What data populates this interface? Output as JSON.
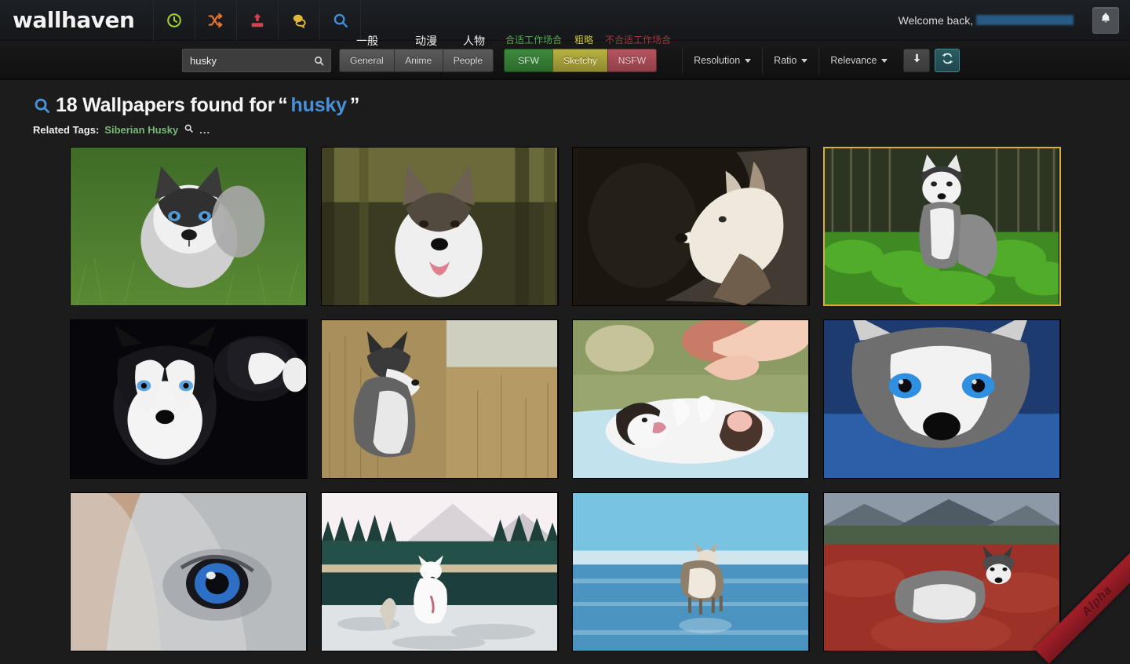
{
  "header": {
    "logo": "wallhaven",
    "nav_icons": [
      {
        "name": "latest-icon",
        "glyph": "clock",
        "color": "#a4d231"
      },
      {
        "name": "random-icon",
        "glyph": "shuffle",
        "color": "#e8732c"
      },
      {
        "name": "upload-icon",
        "glyph": "upload",
        "color": "#d6414f"
      },
      {
        "name": "forums-icon",
        "glyph": "comments",
        "color": "#e0b63b"
      },
      {
        "name": "search-icon",
        "glyph": "magnifier",
        "color": "#3f8ddc"
      }
    ],
    "welcome_text": "Welcome back,",
    "username": "",
    "bell_label": "Notifications"
  },
  "toolbar": {
    "search": {
      "value": "husky",
      "placeholder": "Search...",
      "button_label": "Search"
    },
    "categories": [
      {
        "label": "General",
        "cn": "一般",
        "active": true
      },
      {
        "label": "Anime",
        "cn": "动漫",
        "active": true
      },
      {
        "label": "People",
        "cn": "人物",
        "active": true
      }
    ],
    "purity": [
      {
        "label": "SFW",
        "cn": "合适工作场合",
        "color": "#4caf50",
        "active": true
      },
      {
        "label": "Sketchy",
        "cn": "粗略",
        "color": "#c9c339",
        "active": true
      },
      {
        "label": "NSFW",
        "cn": "不合适工作场合",
        "color": "#a3373f",
        "active": false
      }
    ],
    "dropdowns": [
      {
        "label": "Resolution"
      },
      {
        "label": "Ratio"
      },
      {
        "label": "Relevance"
      }
    ],
    "order_button": "descending",
    "refresh_button": "refresh"
  },
  "results": {
    "count": "18",
    "heading_prefix": "18 Wallpapers found for",
    "quote_open": "“",
    "quote_close": "”",
    "keyword": "husky",
    "related_label": "Related Tags:",
    "related_tags": [
      {
        "label": "Siberian Husky"
      }
    ],
    "related_more": "..."
  },
  "thumbnails": [
    {
      "alt": "husky puppy sitting in green grass",
      "selected": false
    },
    {
      "alt": "husky face with tongue out in forest",
      "selected": false
    },
    {
      "alt": "husky profile in dark interior",
      "selected": false
    },
    {
      "alt": "husky standing among green ferns",
      "selected": true
    },
    {
      "alt": "two husky puppies on black background",
      "selected": false
    },
    {
      "alt": "husky in dry golden grass field",
      "selected": false
    },
    {
      "alt": "hand petting husky puppy on blue blanket",
      "selected": false
    },
    {
      "alt": "close-up husky with bright blue eyes",
      "selected": false
    },
    {
      "alt": "extreme close-up of husky blue eye",
      "selected": false
    },
    {
      "alt": "white husky running by mountain lake",
      "selected": false
    },
    {
      "alt": "husky walking on frozen blue lake",
      "selected": false
    },
    {
      "alt": "husky lying on red tundra hillside",
      "selected": false
    }
  ],
  "footer": {
    "ribbon_label": "Alpha"
  }
}
